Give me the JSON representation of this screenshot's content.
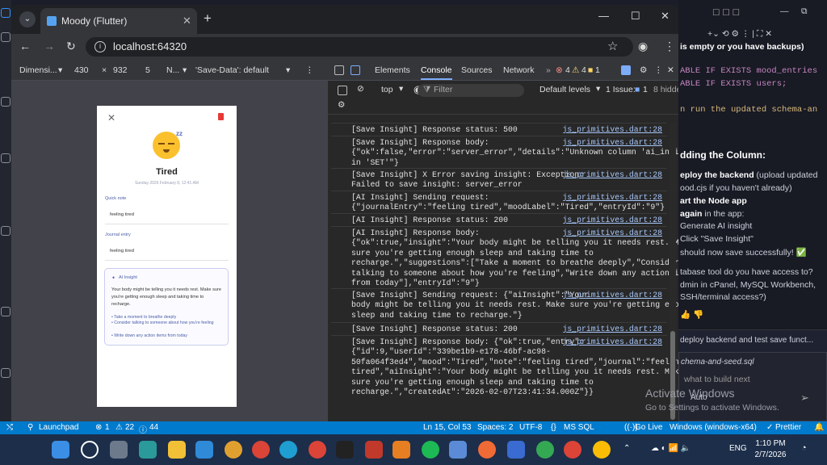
{
  "browser": {
    "tab_title": "Moody (Flutter)",
    "url": "localhost:64320"
  },
  "device_toolbar": {
    "dimensions": "Dimensi...",
    "width": "430",
    "height": "932",
    "zoom": "5",
    "throttle": "N...",
    "save_data": "'Save-Data': default"
  },
  "app": {
    "mood_label": "Tired",
    "date": "Sunday 2026 February 8, 12:41 AM",
    "quick_note_label": "Quick note",
    "quick_note": "feeling tired",
    "journal_label": "Journal entry",
    "journal": "feeling tired",
    "ai_title": "AI Insight",
    "insight": "Your body might be telling you it needs rest. Make sure you're getting enough sleep and taking time to recharge.",
    "suggestions": [
      "• Take a moment to breathe deeply",
      "• Consider talking to someone about how you're feeling",
      "• Write down any action items from today"
    ]
  },
  "devtools": {
    "tabs": [
      "Elements",
      "Console",
      "Sources",
      "Network"
    ],
    "errors": "4",
    "warnings": "4",
    "issues_badge": "1",
    "context": "top",
    "filter_placeholder": "Filter",
    "levels": "Default levels",
    "issue_count": "1 Issue:",
    "issue_num": "1",
    "hidden": "8 hidden"
  },
  "logs": [
    {
      "msg": "[Save Insight] Response status: 500",
      "src": "js_primitives.dart:28"
    },
    {
      "msg": "[Save Insight] Response body:\n{\"ok\":false,\"error\":\"server_error\",\"details\":\"Unknown column 'ai_insight'\nin 'SET'\"}",
      "src": "js_primitives.dart:28"
    },
    {
      "msg": "[Save Insight] X Error saving insight: Exception:\nFailed to save insight: server_error",
      "src": "js_primitives.dart:28"
    },
    {
      "msg": "[AI Insight] Sending request:\n{\"journalEntry\":\"feeling tired\",\"moodLabel\":\"Tired\",\"entryId\":\"9\"}",
      "src": "js_primitives.dart:28"
    },
    {
      "msg": "[AI Insight] Response status: 200",
      "src": "js_primitives.dart:28"
    },
    {
      "msg": "[AI Insight] Response body:\n{\"ok\":true,\"insight\":\"Your body might be telling you it needs rest. Make\nsure you're getting enough sleep and taking time to\nrecharge.\",\"suggestions\":[\"Take a moment to breathe deeply\",\"Consider\ntalking to someone about how you're feeling\",\"Write down any action items\nfrom today\"],\"entryId\":\"9\"}",
      "src": "js_primitives.dart:28"
    },
    {
      "msg": "[Save Insight] Sending request: {\"aiInsight\":\"Your\nbody might be telling you it needs rest. Make sure you're getting enough\nsleep and taking time to recharge.\"}",
      "src": "js_primitives.dart:28"
    },
    {
      "msg": "[Save Insight] Response status: 200",
      "src": "js_primitives.dart:28"
    },
    {
      "msg": "[Save Insight] Response body: {\"ok\":true,\"entry\":\n{\"id\":9,\"userId\":\"339be1b9-e178-46bf-ac98-\n50fa064f3ed4\",\"mood\":\"Tired\",\"note\":\"feeling tired\",\"journal\":\"feeling\ntired\",\"aiInsight\":\"Your body might be telling you it needs rest. Make\nsure you're getting enough sleep and taking time to\nrecharge.\",\"createdAt\":\"2026-02-07T23:41:34.000Z\"}}",
      "src": "js_primitives.dart:28"
    }
  ],
  "side": {
    "line1": "is empty or you have backups)",
    "code1": "ABLE IF EXISTS mood_entries",
    "code2": "ABLE IF EXISTS users;",
    "code3": "n run the updated schema-an",
    "heading": "dding the Column:",
    "s1a": "eploy the backend",
    "s1b": " (upload updated",
    "s2": "ood.cjs   if you haven't already)",
    "s3": "art the Node app",
    "s4a": "again",
    "s4b": " in the app:",
    "s5": "Generate AI insight",
    "s6": "Click \"Save Insight\"",
    "s7": "should now save successfully! ✅",
    "q1": "tabase tool do you have access to?",
    "q2": "dmin in cPanel, MySQL Workbench,",
    "q3": "SSH/terminal access?)",
    "task": "deploy backend and test save funct...",
    "file": "chema-and-seed.sql",
    "input": "what to build next",
    "auto": "Auto"
  },
  "watermark": {
    "title": "Activate Windows",
    "sub": "Go to Settings to activate Windows."
  },
  "status": {
    "launchpad": "Launchpad",
    "errs": "1",
    "warns": "22",
    "info": "44",
    "pos": "Ln 15, Col 53",
    "spaces": "Spaces: 2",
    "enc": "UTF-8",
    "lang": "MS SQL",
    "golive": "Go Live",
    "platform": "Windows (windows-x64)",
    "prettier": "Prettier"
  },
  "tray": {
    "lang": "ENG",
    "time": "1:10 PM",
    "date": "2/7/2026"
  }
}
